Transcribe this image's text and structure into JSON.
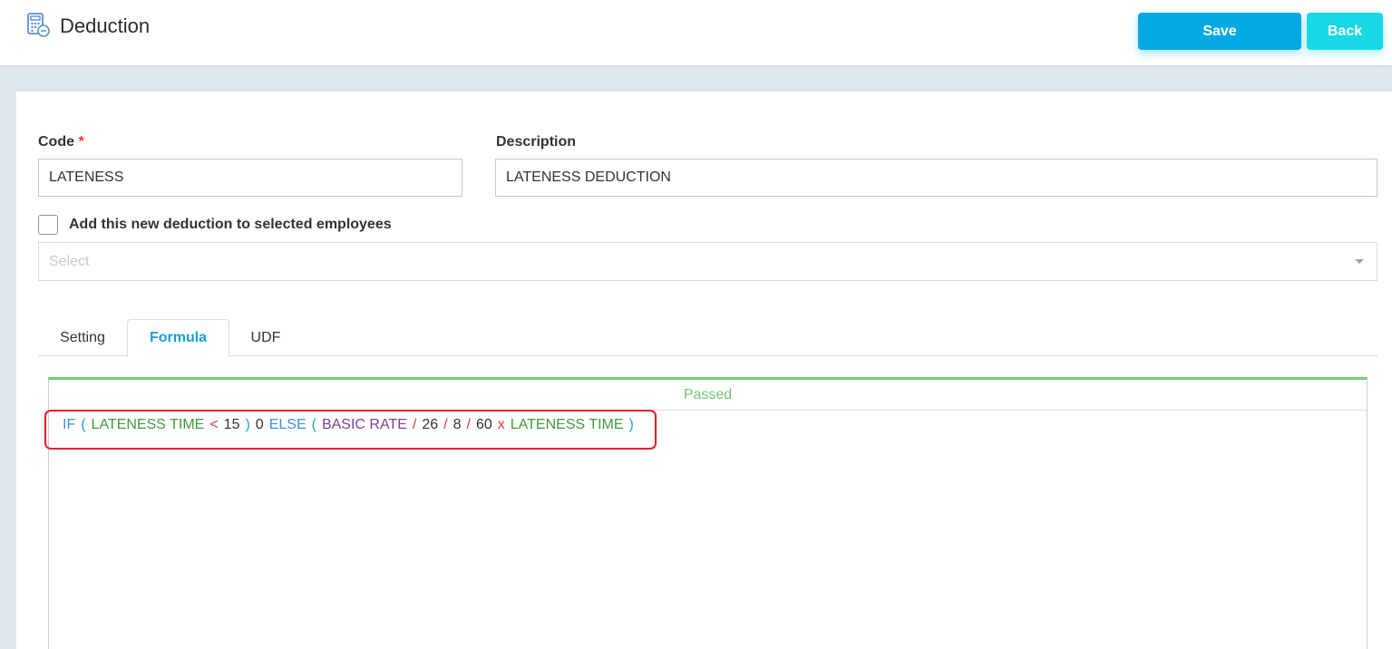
{
  "header": {
    "title": "Deduction",
    "icon": "calculator-icon",
    "save_label": "Save",
    "back_label": "Back"
  },
  "form": {
    "code_label": "Code",
    "code_required_mark": "*",
    "code_value": "LATENESS",
    "description_label": "Description",
    "description_value": "LATENESS DEDUCTION",
    "checkbox_label": "Add this new deduction to selected employees",
    "checkbox_checked": false,
    "select_placeholder": "Select"
  },
  "tabs": [
    {
      "label": "Setting",
      "active": false
    },
    {
      "label": "Formula",
      "active": true
    },
    {
      "label": "UDF",
      "active": false
    }
  ],
  "formula_editor": {
    "status": "Passed",
    "tokens": [
      {
        "text": "IF",
        "kind": "keyword"
      },
      {
        "text": "(",
        "kind": "paren"
      },
      {
        "text": "LATENESS TIME",
        "kind": "var"
      },
      {
        "text": "<",
        "kind": "op"
      },
      {
        "text": "15",
        "kind": "num"
      },
      {
        "text": ")",
        "kind": "paren"
      },
      {
        "text": "0",
        "kind": "num"
      },
      {
        "text": "ELSE",
        "kind": "keyword"
      },
      {
        "text": "(",
        "kind": "paren"
      },
      {
        "text": "BASIC RATE",
        "kind": "rate"
      },
      {
        "text": "/",
        "kind": "op"
      },
      {
        "text": "26",
        "kind": "num"
      },
      {
        "text": "/",
        "kind": "op"
      },
      {
        "text": "8",
        "kind": "num"
      },
      {
        "text": "/",
        "kind": "op"
      },
      {
        "text": "60",
        "kind": "num"
      },
      {
        "text": "x",
        "kind": "op"
      },
      {
        "text": "LATENESS TIME",
        "kind": "var"
      },
      {
        "text": ")",
        "kind": "paren"
      }
    ]
  },
  "colors": {
    "save_button": "#03a9e4",
    "back_button": "#17d8e6",
    "active_tab": "#1a9fd6",
    "passed_status": "#6fc86f",
    "annotation_outline": "#e0202a"
  }
}
